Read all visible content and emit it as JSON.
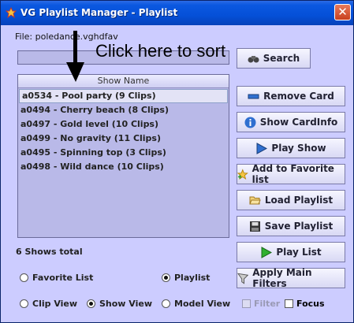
{
  "window": {
    "title": "VG Playlist Manager - Playlist",
    "close_glyph": "✕"
  },
  "file": {
    "label": "File: poledance.vghdfav"
  },
  "search": {
    "value": "",
    "button_label": "Search"
  },
  "list": {
    "header": "Show Name",
    "rows": [
      "a0534 - Pool party (9 Clips)",
      "a0494 - Cherry beach (8 Clips)",
      "a0497 - Gold level (10 Clips)",
      "a0499 - No gravity (11 Clips)",
      "a0495 - Spinning top (3 Clips)",
      "a0498 - Wild dance (10 Clips)"
    ],
    "selected_index": 0
  },
  "count": {
    "label": "6 Shows total"
  },
  "buttons": {
    "remove_card": "Remove Card",
    "show_cardinfo": "Show CardInfo",
    "play_show": "Play Show",
    "add_favorite": "Add to Favorite list",
    "load_playlist": "Load Playlist",
    "save_playlist": "Save Playlist",
    "play_list": "Play List",
    "apply_filters": "Apply Main Filters"
  },
  "list_mode": {
    "favorite": "Favorite List",
    "playlist": "Playlist",
    "selected": "playlist"
  },
  "view_mode": {
    "clip": "Clip View",
    "show": "Show View",
    "model": "Model View",
    "selected": "show"
  },
  "checks": {
    "filter": "Filter",
    "filter_checked": false,
    "filter_enabled": false,
    "focus": "Focus",
    "focus_checked": false
  },
  "annotation": {
    "text": "Click here to sort"
  },
  "colors": {
    "window_bg": "#ccccff",
    "titlebar": "#0550d8",
    "list_bg": "#b9b9e8",
    "close": "#c8401e"
  }
}
